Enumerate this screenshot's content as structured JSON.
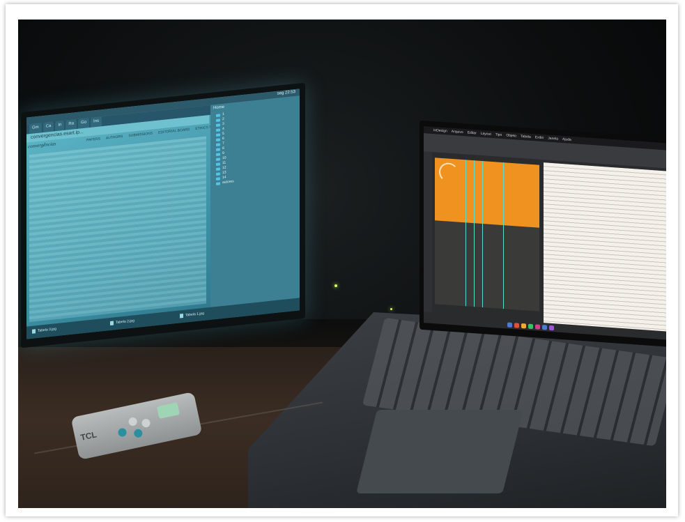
{
  "monitor": {
    "menubar_status": "seg 22:53",
    "sidebar_title": "Home",
    "tabs": [
      "Gm",
      "Ca",
      "In",
      "Ra",
      "Go",
      "Ins"
    ],
    "address": "convergencias.esart.ip...",
    "logo": "convergências",
    "nav": [
      "PAPERS",
      "AUTHORS",
      "SUBMISSIONS",
      "EDITORIAL BOARD",
      "ETHICS STATEMENT"
    ],
    "folders": [
      "1",
      "2",
      "3",
      "4",
      "5",
      "6",
      "7",
      "8",
      "9",
      "10",
      "11",
      "12",
      "13",
      "14",
      "autores"
    ],
    "downloads": [
      "Tabela 3.jpg",
      "Tabela 2.jpg",
      "Tabela 1.jpg"
    ]
  },
  "laptop": {
    "menu": [
      "InDesign",
      "Arquivo",
      "Editar",
      "Layout",
      "Tipo",
      "Objeto",
      "Tabela",
      "Exibir",
      "Janela",
      "Ajuda"
    ]
  },
  "remote": {
    "brand": "TCL"
  }
}
